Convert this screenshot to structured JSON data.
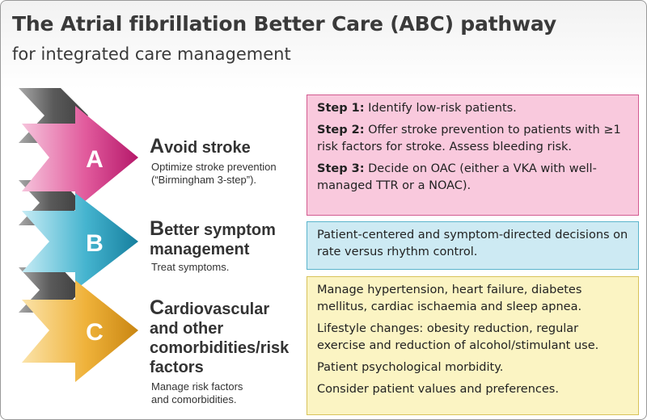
{
  "title": "The Atrial fibrillation Better Care (ABC) pathway",
  "subtitle": "for integrated care management",
  "colors": {
    "a_arrow": "#d22f7e",
    "b_arrow": "#29a3c0",
    "c_arrow": "#ecaa1a",
    "a_box_bg": "#f9c9dd",
    "b_box_bg": "#cdeaf3",
    "c_box_bg": "#fbf4c3"
  },
  "steps": [
    {
      "letter": "A",
      "heading_first": "A",
      "heading_rest": "void stroke",
      "sub_line1": "Optimize stroke prevention",
      "sub_line2": "(“Birmingham 3-step”).",
      "box": [
        {
          "bold": "Step 1:",
          "text": " Identify low-risk patients."
        },
        {
          "bold": "Step 2:",
          "text": " Offer stroke prevention to patients with ≥1 risk factors for stroke. Assess bleeding risk."
        },
        {
          "bold": "Step 3:",
          "text": " Decide on OAC (either a VKA with well-managed TTR or a NOAC)."
        }
      ]
    },
    {
      "letter": "B",
      "heading_first": "B",
      "heading_rest1": "etter symptom",
      "heading_line2": "management",
      "sub_line1": "Treat symptoms.",
      "box": [
        "Patient-centered and symptom-directed decisions on rate versus rhythm control."
      ]
    },
    {
      "letter": "C",
      "heading_first": "C",
      "heading_rest1": "ardiovascular",
      "heading_line2": "and other",
      "heading_line3": "comorbidities/risk",
      "heading_line4": "factors",
      "sub_line1": "Manage risk factors",
      "sub_line2": "and comorbidities.",
      "box": [
        "Manage hypertension, heart failure, diabetes mellitus, cardiac ischaemia and sleep apnea.",
        "Lifestyle changes: obesity reduction, regular exercise and reduction of alcohol/stimulant use.",
        "Patient psychological morbidity.",
        "Consider patient values and preferences."
      ]
    }
  ]
}
